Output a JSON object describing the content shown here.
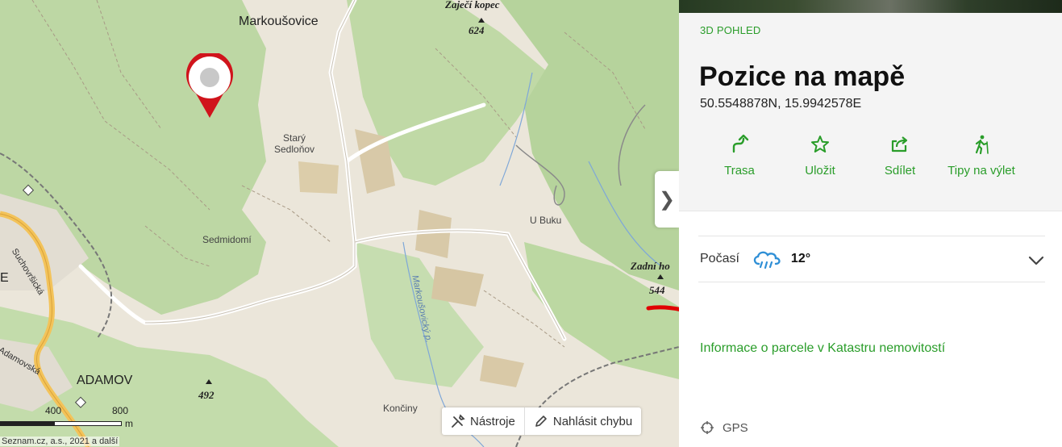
{
  "map": {
    "labels": {
      "markousovice": "Markoušovice",
      "zajeci_kopec": "Zaječí kopec",
      "zajeci_alt": "624",
      "stary_sedlonov": "Starý\nSedloňov",
      "u_buku": "U Buku",
      "sedmidomi": "Sedmidomí",
      "zadni_hora": "Zadní ho",
      "zadni_alt": "544",
      "suchovrsicka": "Suchovršická",
      "markousovicky": "Markoušovický p.",
      "adamovska": "Adamovská",
      "adamov": "ADAMOV",
      "alt_492": "492",
      "konciny": "Končiny",
      "edge_e": "E"
    },
    "scale": {
      "label_400": "400",
      "label_800": "800",
      "unit": "m"
    },
    "copyright": "Seznam.cz, a.s., 2021 a další",
    "tools": {
      "tools_label": "Nástroje",
      "report_label": "Nahlásit chybu"
    },
    "collapse_glyph": "❯"
  },
  "panel": {
    "view3d": "3D POHLED",
    "title": "Pozice na mapě",
    "coords": "50.5548878N, 15.9942578E",
    "actions": [
      {
        "label": "Trasa",
        "icon": "route-icon"
      },
      {
        "label": "Uložit",
        "icon": "star-icon"
      },
      {
        "label": "Sdílet",
        "icon": "share-icon"
      },
      {
        "label": "Tipy na výlet",
        "icon": "hiker-icon"
      }
    ],
    "weather": {
      "label": "Počasí",
      "temp": "12°",
      "icon": "rain-cloud-icon"
    },
    "cadastre_link": "Informace o parcele v Katastru nemovitostí",
    "gps": "GPS"
  },
  "colors": {
    "accent": "#2a9d2a",
    "pin": "#d0141c",
    "forest": "#b9d5a0",
    "road_yellow": "#f3c35a"
  }
}
